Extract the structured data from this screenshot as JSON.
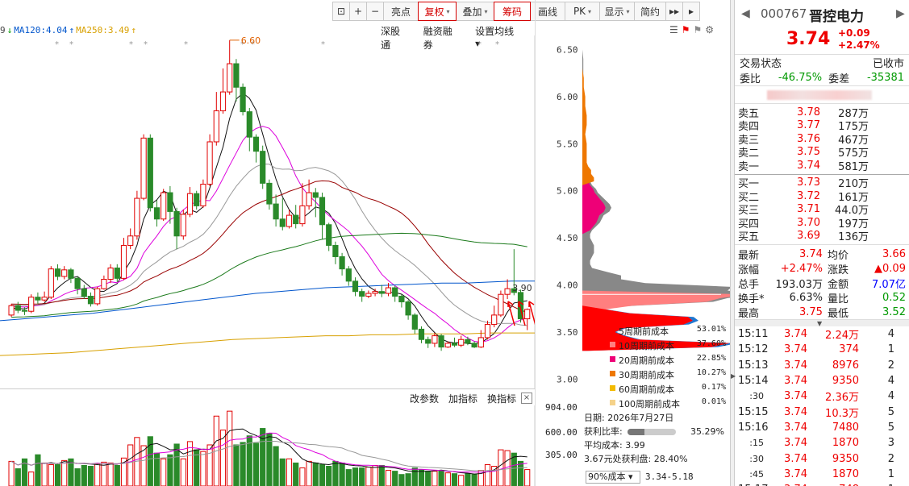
{
  "toolbar": {
    "items": [
      {
        "label": "⊡",
        "on": false
      },
      {
        "label": "+",
        "on": false
      },
      {
        "label": "−",
        "on": false
      },
      {
        "label": "亮点",
        "on": false
      },
      {
        "label": "复权",
        "on": true,
        "dd": true
      },
      {
        "label": "叠加",
        "on": false,
        "dd": true
      },
      {
        "label": "筹码",
        "on": true
      },
      {
        "label": "画线",
        "on": false
      },
      {
        "label": "PK",
        "on": false,
        "dd": true
      },
      {
        "label": "显示",
        "on": false,
        "dd": true
      },
      {
        "label": "简约",
        "on": false
      },
      {
        "label": "▸▸",
        "on": false
      },
      {
        "label": "▸",
        "on": false
      }
    ]
  },
  "legend": [
    {
      "text": "9",
      "color": "#444"
    },
    {
      "text": "↓",
      "color": "#090"
    },
    {
      "text": "MA120:4.04",
      "color": "#0055cc"
    },
    {
      "text": "↑",
      "color": "#0055cc"
    },
    {
      "text": "MA250:3.49",
      "color": "#d8a000"
    },
    {
      "text": "↑",
      "color": "#d8a000"
    }
  ],
  "top_links": [
    "深股通",
    "融资融券",
    "设置均线 ▾"
  ],
  "price_axis": {
    "min": 2.9,
    "max": 6.65,
    "ticks": [
      "6.50",
      "6.00",
      "5.50",
      "5.00",
      "4.50",
      "4.00",
      "3.50",
      "3.00"
    ]
  },
  "annotations": {
    "high": "6.60",
    "last": "3.90"
  },
  "vol_head": [
    "改参数",
    "加指标",
    "换指标"
  ],
  "vol_close": "×",
  "vol_axis": {
    "ticks": [
      "904.00",
      "600.00",
      "305.00"
    ]
  },
  "colors": {
    "up": "#e00000",
    "down": "#2a8a2a"
  },
  "candles": [
    [
      3.68,
      3.78,
      3.66,
      3.8
    ],
    [
      3.78,
      3.73,
      3.7,
      3.82
    ],
    [
      3.73,
      3.72,
      3.68,
      3.76
    ],
    [
      3.72,
      3.87,
      3.7,
      3.9
    ],
    [
      3.87,
      3.84,
      3.8,
      3.92
    ],
    [
      3.84,
      3.87,
      3.82,
      3.93
    ],
    [
      3.87,
      4.17,
      3.85,
      4.2
    ],
    [
      4.17,
      4.09,
      4.05,
      4.22
    ],
    [
      4.09,
      4.16,
      4.06,
      4.2
    ],
    [
      4.16,
      4.07,
      4.02,
      4.18
    ],
    [
      4.07,
      3.96,
      3.9,
      4.09
    ],
    [
      3.96,
      3.88,
      3.85,
      4.0
    ],
    [
      3.88,
      3.8,
      3.77,
      3.92
    ],
    [
      3.8,
      3.96,
      3.78,
      3.98
    ],
    [
      3.96,
      4.06,
      3.95,
      4.1
    ],
    [
      4.06,
      4.18,
      4.02,
      4.22
    ],
    [
      4.18,
      4.07,
      4.03,
      4.22
    ],
    [
      4.07,
      4.42,
      4.05,
      4.5
    ],
    [
      4.42,
      4.52,
      4.38,
      4.6
    ],
    [
      4.52,
      4.92,
      4.48,
      5.0
    ],
    [
      4.92,
      5.56,
      4.9,
      5.6
    ],
    [
      5.56,
      4.82,
      4.78,
      5.6
    ],
    [
      4.82,
      4.7,
      4.62,
      4.9
    ],
    [
      4.7,
      4.98,
      4.68,
      5.02
    ],
    [
      4.98,
      4.78,
      4.65,
      5.05
    ],
    [
      4.78,
      4.52,
      4.38,
      4.82
    ],
    [
      4.52,
      4.75,
      4.48,
      4.8
    ],
    [
      4.75,
      4.97,
      4.72,
      5.04
    ],
    [
      4.97,
      4.84,
      4.8,
      5.0
    ],
    [
      4.84,
      5.07,
      4.82,
      5.12
    ],
    [
      5.07,
      5.52,
      5.05,
      5.6
    ],
    [
      5.52,
      5.85,
      5.48,
      6.05
    ],
    [
      5.85,
      6.05,
      5.82,
      6.3
    ],
    [
      6.05,
      6.35,
      6.02,
      6.6
    ],
    [
      6.35,
      6.1,
      5.95,
      6.4
    ],
    [
      6.1,
      5.84,
      5.8,
      6.14
    ],
    [
      5.84,
      5.57,
      5.42,
      5.88
    ],
    [
      5.57,
      5.42,
      5.3,
      5.6
    ],
    [
      5.42,
      5.08,
      5.02,
      5.48
    ],
    [
      5.08,
      4.86,
      4.8,
      5.12
    ],
    [
      4.86,
      4.7,
      4.62,
      4.96
    ],
    [
      4.7,
      4.62,
      4.58,
      4.92
    ],
    [
      4.62,
      4.74,
      4.6,
      4.8
    ],
    [
      4.74,
      4.65,
      4.6,
      4.85
    ],
    [
      4.65,
      4.84,
      4.62,
      5.08
    ],
    [
      4.84,
      4.98,
      4.8,
      5.12
    ],
    [
      4.98,
      4.93,
      4.72,
      5.03
    ],
    [
      4.93,
      4.64,
      4.48,
      4.98
    ],
    [
      4.64,
      4.42,
      4.36,
      4.66
    ],
    [
      4.42,
      4.3,
      4.22,
      4.46
    ],
    [
      4.3,
      4.17,
      4.1,
      4.34
    ],
    [
      4.17,
      4.04,
      3.99,
      4.2
    ],
    [
      4.04,
      3.93,
      3.88,
      4.08
    ],
    [
      3.93,
      3.88,
      3.82,
      3.96
    ],
    [
      3.88,
      3.91,
      3.86,
      3.94
    ],
    [
      3.91,
      3.93,
      3.88,
      3.96
    ],
    [
      3.93,
      3.91,
      3.87,
      4.0
    ],
    [
      3.91,
      3.97,
      3.88,
      4.02
    ],
    [
      3.97,
      3.88,
      3.82,
      3.99
    ],
    [
      3.88,
      3.82,
      3.76,
      3.9
    ],
    [
      3.82,
      3.68,
      3.63,
      3.84
    ],
    [
      3.68,
      3.53,
      3.48,
      3.7
    ],
    [
      3.53,
      3.42,
      3.38,
      3.56
    ],
    [
      3.42,
      3.38,
      3.33,
      3.45
    ],
    [
      3.38,
      3.46,
      3.34,
      3.49
    ],
    [
      3.46,
      3.34,
      3.3,
      3.48
    ],
    [
      3.34,
      3.38,
      3.33,
      3.4
    ],
    [
      3.38,
      3.36,
      3.34,
      3.44
    ],
    [
      3.36,
      3.42,
      3.34,
      3.46
    ],
    [
      3.42,
      3.38,
      3.36,
      3.45
    ],
    [
      3.38,
      3.34,
      3.33,
      3.4
    ],
    [
      3.34,
      3.44,
      3.33,
      3.52
    ],
    [
      3.44,
      3.58,
      3.42,
      3.62
    ],
    [
      3.58,
      3.68,
      3.55,
      3.78
    ],
    [
      3.68,
      3.9,
      3.66,
      3.94
    ],
    [
      3.9,
      3.96,
      3.85,
      4.06
    ],
    [
      3.96,
      3.92,
      3.89,
      4.38
    ],
    [
      3.92,
      3.64,
      3.6,
      3.95
    ],
    [
      3.64,
      3.74,
      3.52,
      3.75
    ]
  ],
  "volumes": [
    300,
    210,
    330,
    170,
    380,
    280,
    260,
    260,
    310,
    330,
    210,
    250,
    240,
    270,
    290,
    280,
    250,
    340,
    500,
    590,
    490,
    600,
    400,
    330,
    380,
    510,
    330,
    540,
    440,
    420,
    500,
    850,
    680,
    910,
    500,
    530,
    610,
    520,
    700,
    640,
    480,
    330,
    330,
    280,
    220,
    300,
    280,
    260,
    240,
    300,
    280,
    200,
    220,
    220,
    230,
    250,
    250,
    190,
    180,
    140,
    150,
    220,
    200,
    180,
    180,
    190,
    160,
    150,
    130,
    150,
    140,
    190,
    260,
    240,
    440,
    430,
    400,
    300,
    200
  ],
  "ma_lines": [
    {
      "name": "MA5",
      "color": "#111111",
      "period": 5
    },
    {
      "name": "MA10",
      "color": "#dd00dd",
      "period": 10
    },
    {
      "name": "MA20",
      "color": "#999999",
      "period": 20
    },
    {
      "name": "MA30",
      "color": "#990000",
      "period": 30
    },
    {
      "name": "MA60",
      "color": "#1b7a1b",
      "period": 60
    }
  ],
  "ma120": [
    3.62,
    3.64,
    3.66,
    3.68,
    3.7,
    3.73,
    3.76,
    3.79,
    3.82,
    3.85,
    3.88,
    3.91,
    3.93,
    3.95,
    3.97,
    3.98,
    3.99,
    4.0,
    4.01,
    4.02,
    4.02,
    4.03,
    4.04,
    4.04
  ],
  "ma250": [
    3.25,
    3.26,
    3.27,
    3.28,
    3.3,
    3.32,
    3.34,
    3.36,
    3.38,
    3.4,
    3.42,
    3.43,
    3.44,
    3.45,
    3.46,
    3.46,
    3.47,
    3.47,
    3.48,
    3.48,
    3.48,
    3.49,
    3.49,
    3.49
  ],
  "chips": {
    "profile": [
      [
        3.3,
        5
      ],
      [
        3.34,
        140
      ],
      [
        3.38,
        160
      ],
      [
        3.42,
        60
      ],
      [
        3.46,
        45
      ],
      [
        3.5,
        35
      ],
      [
        3.54,
        45
      ],
      [
        3.58,
        110
      ],
      [
        3.62,
        120
      ],
      [
        3.66,
        115
      ],
      [
        3.7,
        50
      ],
      [
        3.74,
        25
      ],
      [
        3.78,
        55
      ],
      [
        3.82,
        135
      ],
      [
        3.86,
        150
      ],
      [
        3.9,
        180
      ],
      [
        3.94,
        150
      ],
      [
        3.98,
        155
      ],
      [
        4.02,
        65
      ],
      [
        4.06,
        40
      ],
      [
        4.1,
        40
      ],
      [
        4.14,
        25
      ],
      [
        4.18,
        10
      ],
      [
        4.22,
        8
      ],
      [
        4.26,
        8
      ],
      [
        4.3,
        10
      ],
      [
        4.34,
        12
      ],
      [
        4.38,
        12
      ],
      [
        4.42,
        12
      ],
      [
        4.46,
        10
      ],
      [
        4.5,
        8
      ],
      [
        4.54,
        8
      ],
      [
        4.58,
        10
      ],
      [
        4.62,
        14
      ],
      [
        4.66,
        18
      ],
      [
        4.7,
        20
      ],
      [
        4.74,
        22
      ],
      [
        4.78,
        28
      ],
      [
        4.82,
        30
      ],
      [
        4.86,
        28
      ],
      [
        4.9,
        24
      ],
      [
        4.94,
        20
      ],
      [
        4.98,
        16
      ],
      [
        5.02,
        14
      ],
      [
        5.06,
        10
      ],
      [
        5.1,
        8
      ],
      [
        5.14,
        8
      ],
      [
        5.18,
        6
      ],
      [
        5.22,
        6
      ],
      [
        5.26,
        4
      ],
      [
        5.3,
        3
      ],
      [
        5.35,
        3
      ],
      [
        5.4,
        3
      ],
      [
        5.5,
        3
      ],
      [
        5.6,
        2
      ],
      [
        5.7,
        3
      ],
      [
        5.8,
        3
      ],
      [
        5.9,
        2
      ],
      [
        6.0,
        2
      ],
      [
        6.1,
        1
      ],
      [
        6.2,
        1
      ],
      [
        6.3,
        1
      ],
      [
        6.4,
        1
      ],
      [
        6.5,
        0
      ]
    ],
    "legend": [
      {
        "label": "5周期前成本",
        "pct": "53.01%",
        "color": "#ff0000"
      },
      {
        "label": "10周期前成本",
        "pct": "37.60%",
        "color": "#ff7f7f"
      },
      {
        "label": "20周期前成本",
        "pct": "22.85%",
        "color": "#ee0077"
      },
      {
        "label": "30周期前成本",
        "pct": "10.27%",
        "color": "#ee7700"
      },
      {
        "label": "60周期前成本",
        "pct": "0.17%",
        "color": "#f3bb00"
      },
      {
        "label": "100周期前成本",
        "pct": "0.01%",
        "color": "#f5d28a"
      }
    ],
    "info": {
      "date": "日期: 2026年7月27日",
      "profit_label": "获利比率:",
      "profit_pct": "35.29%",
      "avg": "平均成本: 3.99",
      "at_price": "3.67元处获利盘: 28.40%"
    },
    "select": "90%成本 ▾",
    "range": "3.34-5.18"
  },
  "quote": {
    "code": "000767",
    "name": "晋控电力",
    "price": "3.74",
    "chg": "+0.09",
    "chg_pct": "+2.47%",
    "status_label": "交易状态",
    "status_value": "已收市",
    "weibi_label": "委比",
    "weibi": "-46.75%",
    "weicha_label": "委差",
    "weicha": "-35381",
    "sell": [
      {
        "l": "卖五",
        "p": "3.78",
        "v": "287万"
      },
      {
        "l": "卖四",
        "p": "3.77",
        "v": "175万"
      },
      {
        "l": "卖三",
        "p": "3.76",
        "v": "467万"
      },
      {
        "l": "卖二",
        "p": "3.75",
        "v": "575万"
      },
      {
        "l": "卖一",
        "p": "3.74",
        "v": "581万"
      }
    ],
    "buy": [
      {
        "l": "买一",
        "p": "3.73",
        "v": "210万"
      },
      {
        "l": "买二",
        "p": "3.72",
        "v": "161万"
      },
      {
        "l": "买三",
        "p": "3.71",
        "v": "44.0万"
      },
      {
        "l": "买四",
        "p": "3.70",
        "v": "197万"
      },
      {
        "l": "买五",
        "p": "3.69",
        "v": "136万"
      }
    ],
    "stats": [
      {
        "k": "最新",
        "v": "3.74",
        "vc": "red",
        "k2": "均价",
        "v2": "3.66",
        "v2c": "red"
      },
      {
        "k": "涨幅",
        "v": "+2.47%",
        "vc": "red",
        "k2": "涨跌",
        "v2": "▲0.09",
        "v2c": "red"
      },
      {
        "k": "总手",
        "v": "193.03万",
        "vc": "",
        "k2": "金额",
        "v2": "7.07亿",
        "v2c": "blu"
      },
      {
        "k": "换手*",
        "v": "6.63%",
        "vc": "",
        "k2": "量比",
        "v2": "0.52",
        "v2c": "grn"
      },
      {
        "k": "最高",
        "v": "3.75",
        "vc": "red",
        "k2": "最低",
        "v2": "3.52",
        "v2c": "grn"
      }
    ],
    "ticks": [
      {
        "t": "15:11",
        "p": "3.74",
        "v": "2.24万",
        "n": "4",
        "s": false
      },
      {
        "t": "15:12",
        "p": "3.74",
        "v": "374",
        "n": "1",
        "s": false
      },
      {
        "t": "15:13",
        "p": "3.74",
        "v": "8976",
        "n": "2",
        "s": false
      },
      {
        "t": "15:14",
        "p": "3.74",
        "v": "9350",
        "n": "4",
        "s": false
      },
      {
        "t": ":30",
        "p": "3.74",
        "v": "2.36万",
        "n": "4",
        "s": true
      },
      {
        "t": "15:15",
        "p": "3.74",
        "v": "10.3万",
        "n": "5",
        "s": false
      },
      {
        "t": "15:16",
        "p": "3.74",
        "v": "7480",
        "n": "5",
        "s": false
      },
      {
        "t": ":15",
        "p": "3.74",
        "v": "1870",
        "n": "3",
        "s": true
      },
      {
        "t": ":30",
        "p": "3.74",
        "v": "9350",
        "n": "2",
        "s": true
      },
      {
        "t": ":45",
        "p": "3.74",
        "v": "1870",
        "n": "1",
        "s": true
      },
      {
        "t": "15:17",
        "p": "3.74",
        "v": "748",
        "n": "1",
        "s": false
      }
    ]
  }
}
